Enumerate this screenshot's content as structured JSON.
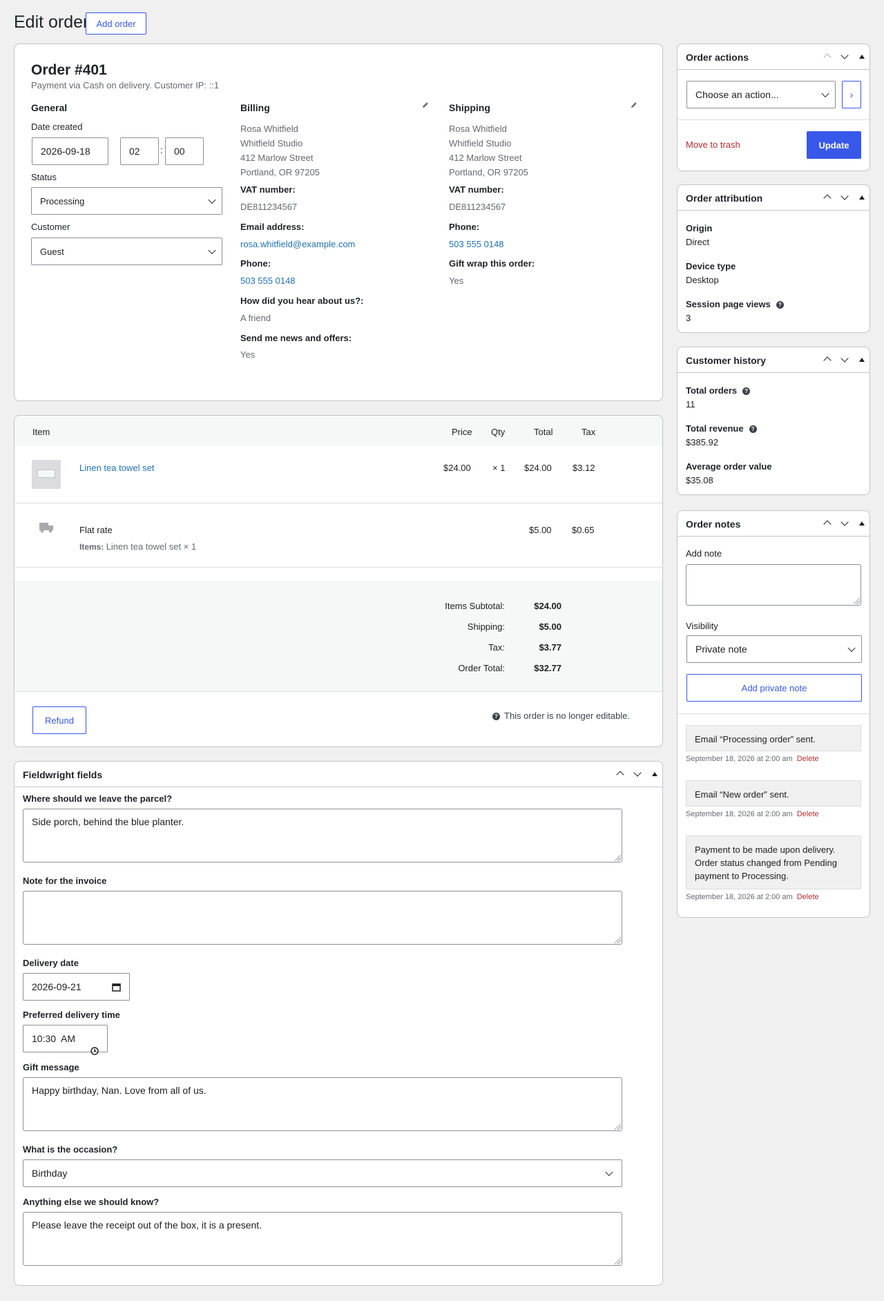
{
  "header": {
    "title": "Edit order",
    "add_order_label": "Add order"
  },
  "order": {
    "title": "Order #401",
    "subtitle": "Payment via Cash on delivery. Customer IP: ::1",
    "general": {
      "heading": "General",
      "date_label": "Date created",
      "date_value": "2026-09-18",
      "hour_value": "02",
      "time_sep": ":",
      "minute_value": "00",
      "status_label": "Status",
      "status_value": "Processing",
      "customer_label": "Customer",
      "customer_value": "Guest"
    },
    "billing": {
      "heading": "Billing",
      "address": [
        "Rosa Whitfield",
        "Whitfield Studio",
        "412 Marlow Street",
        "Portland, OR 97205"
      ],
      "vat_label": "VAT number:",
      "vat_value": "DE811234567",
      "email_label": "Email address:",
      "email_value": "rosa.whitfield@example.com",
      "phone_label": "Phone:",
      "phone_value": "503 555 0148",
      "hear_label": "How did you hear about us?:",
      "hear_value": "A friend",
      "news_label": "Send me news and offers:",
      "news_value": "Yes"
    },
    "shipping": {
      "heading": "Shipping",
      "address": [
        "Rosa Whitfield",
        "Whitfield Studio",
        "412 Marlow Street",
        "Portland, OR 97205"
      ],
      "vat_label": "VAT number:",
      "vat_value": "DE811234567",
      "phone_label": "Phone:",
      "phone_value": "503 555 0148",
      "gift_label": "Gift wrap this order:",
      "gift_value": "Yes"
    }
  },
  "items": {
    "headers": {
      "item": "Item",
      "price": "Price",
      "qty": "Qty",
      "total": "Total",
      "tax": "Tax"
    },
    "line": {
      "name": "Linen tea towel set",
      "price": "$24.00",
      "qty": "× 1",
      "total": "$24.00",
      "tax": "$3.12"
    },
    "shipping": {
      "name": "Flat rate",
      "items_label": "Items:",
      "items_value": "Linen tea towel set × 1",
      "total": "$5.00",
      "tax": "$0.65"
    },
    "totals": [
      {
        "label": "Items Subtotal:",
        "value": "$24.00"
      },
      {
        "label": "Shipping:",
        "value": "$5.00"
      },
      {
        "label": "Tax:",
        "value": "$3.77"
      },
      {
        "label": "Order Total:",
        "value": "$32.77"
      }
    ],
    "refund_label": "Refund",
    "not_editable": "This order is no longer editable."
  },
  "custom": {
    "title": "Fieldwright fields",
    "parcel_label": "Where should we leave the parcel?",
    "parcel_value": "Side porch, behind the blue planter.",
    "invoice_label": "Note for the invoice",
    "invoice_value": "",
    "delivery_date_label": "Delivery date",
    "delivery_date_value": "2026-09-21",
    "time_label": "Preferred delivery time",
    "time_value": "10:30  AM",
    "gift_label": "Gift message",
    "gift_value": "Happy birthday, Nan. Love from all of us.",
    "occasion_label": "What is the occasion?",
    "occasion_value": "Birthday",
    "else_label": "Anything else we should know?",
    "else_value": "Please leave the receipt out of the box, it is a present."
  },
  "sidebar": {
    "actions": {
      "title": "Order actions",
      "select_value": "Choose an action...",
      "trash": "Move to trash",
      "update": "Update"
    },
    "attribution": {
      "title": "Order attribution",
      "origin_label": "Origin",
      "origin_value": "Direct",
      "device_label": "Device type",
      "device_value": "Desktop",
      "views_label": "Session page views",
      "views_value": "3"
    },
    "history": {
      "title": "Customer history",
      "orders_label": "Total orders",
      "orders_value": "11",
      "revenue_label": "Total revenue",
      "revenue_value": "$385.92",
      "aov_label": "Average order value",
      "aov_value": "$35.08"
    },
    "notes": {
      "title": "Order notes",
      "add_label": "Add note",
      "visibility_label": "Visibility",
      "visibility_value": "Private note",
      "add_button": "Add private note",
      "list": [
        {
          "text": "Email “Processing order” sent.",
          "meta": "September 18, 2026 at 2:00 am",
          "delete": "Delete"
        },
        {
          "text": "Email “New order” sent.",
          "meta": "September 18, 2026 at 2:00 am",
          "delete": "Delete"
        },
        {
          "text": "Payment to be made upon delivery. Order status changed from Pending payment to Processing.",
          "meta": "September 18, 2026 at 2:00 am",
          "delete": "Delete"
        }
      ]
    }
  },
  "colors": {
    "accent": "#3858e9",
    "link": "#2271b1",
    "danger": "#b32d2e",
    "background": "#f0f0f1"
  }
}
